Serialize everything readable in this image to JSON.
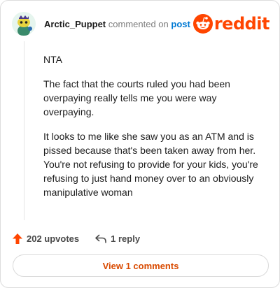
{
  "header": {
    "username": "Arctic_Puppet",
    "action_text": "commented on",
    "post_link": "post",
    "logo_word": "reddit"
  },
  "comment": {
    "paragraphs": [
      "NTA",
      "The fact that the courts ruled you had been overpaying really tells me you were way overpaying.",
      "It looks to me like she saw you as an ATM and is pissed because that's been taken away from her. You're not refusing to provide for your kids, you're refusing to just hand money over to an obviously manipulative woman"
    ]
  },
  "actions": {
    "upvotes_label": "202 upvotes",
    "reply_label": "1 reply"
  },
  "view_button_label": "View 1 comments",
  "colors": {
    "brand": "#ff4500",
    "link": "#0079d3",
    "view_button_text": "#d94a00"
  },
  "icons": {
    "upvote": "upvote-arrow-icon",
    "reply": "reply-arrow-icon",
    "avatar": "snoo-avatar-icon",
    "logo": "reddit-snoo-icon"
  }
}
